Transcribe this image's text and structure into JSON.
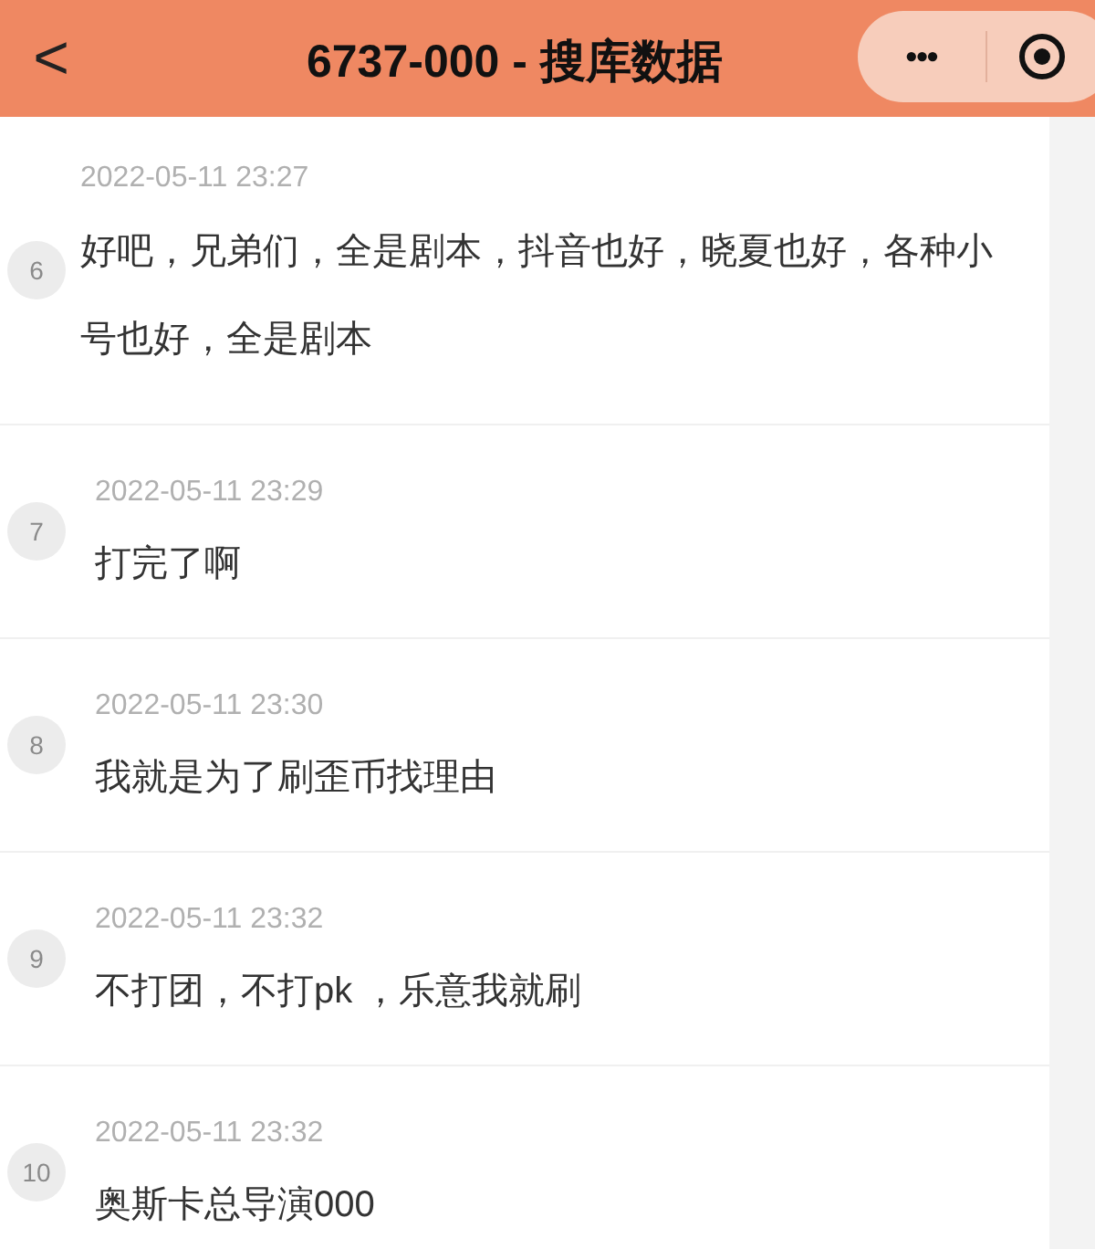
{
  "header": {
    "back": "<",
    "title": "6737-000 - 搜库数据",
    "more": "•••"
  },
  "comments": [
    {
      "number": "6",
      "time": "2022-05-11 23:27",
      "text": "好吧，兄弟们，全是剧本，抖音也好，晓夏也好，各种小号也好，全是剧本"
    },
    {
      "number": "7",
      "time": "2022-05-11 23:29",
      "text": "打完了啊"
    },
    {
      "number": "8",
      "time": "2022-05-11 23:30",
      "text": "我就是为了刷歪币找理由"
    },
    {
      "number": "9",
      "time": "2022-05-11 23:32",
      "text": "不打团，不打pk ，乐意我就刷"
    },
    {
      "number": "10",
      "time": "2022-05-11 23:32",
      "text": "奥斯卡总导演000"
    }
  ]
}
